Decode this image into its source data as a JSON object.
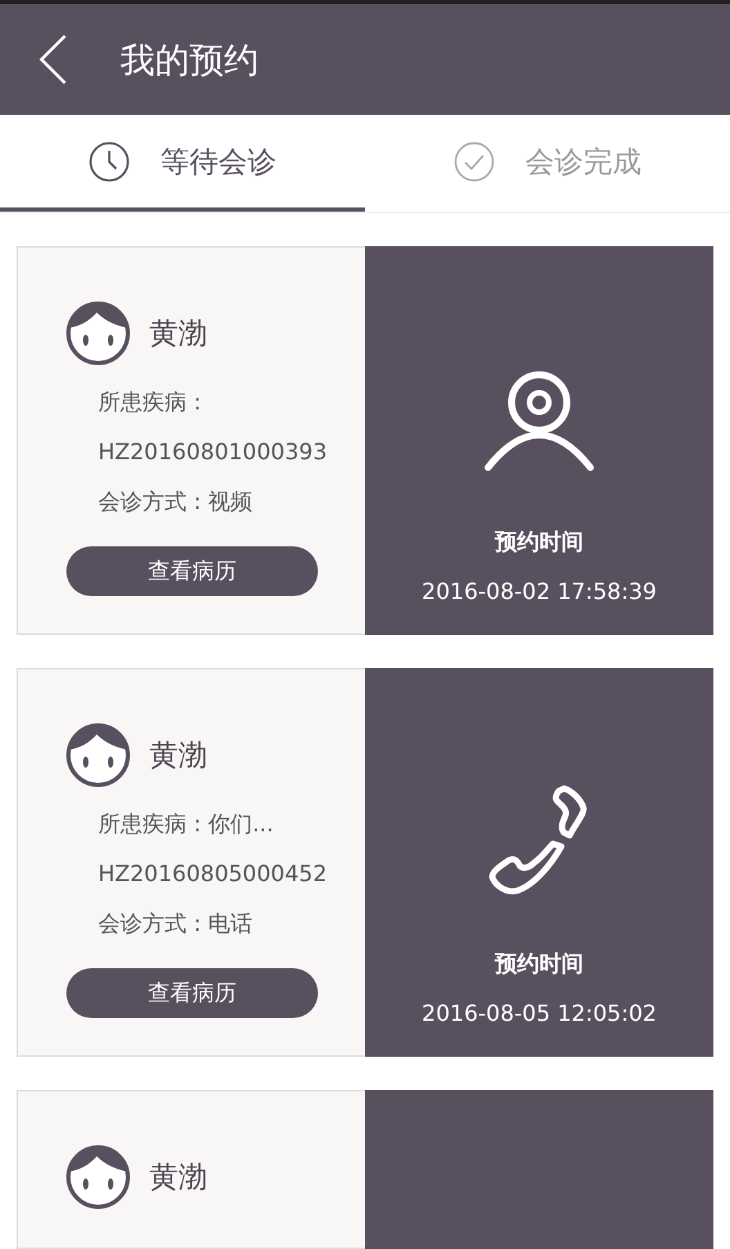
{
  "header": {
    "title": "我的预约"
  },
  "tabs": [
    {
      "label": "等待会诊",
      "selected": true,
      "kind": "clock"
    },
    {
      "label": "会诊完成",
      "selected": false,
      "kind": "check"
    }
  ],
  "appointments": [
    {
      "kind": "video",
      "name": "黄渤",
      "disease": "所患疾病 :",
      "record_no": "HZ20160801000393",
      "method": "会诊方式 : 视频",
      "button": "查看病历",
      "time_label": "预约时间",
      "time": "2016-08-02 17:58:39"
    },
    {
      "kind": "phone",
      "name": "黄渤",
      "disease": "所患疾病 : 你们...",
      "record_no": "HZ20160805000452",
      "method": "会诊方式 : 电话",
      "button": "查看病历",
      "time_label": "预约时间",
      "time": "2016-08-05 12:05:02"
    },
    {
      "name": "黄渤"
    }
  ]
}
